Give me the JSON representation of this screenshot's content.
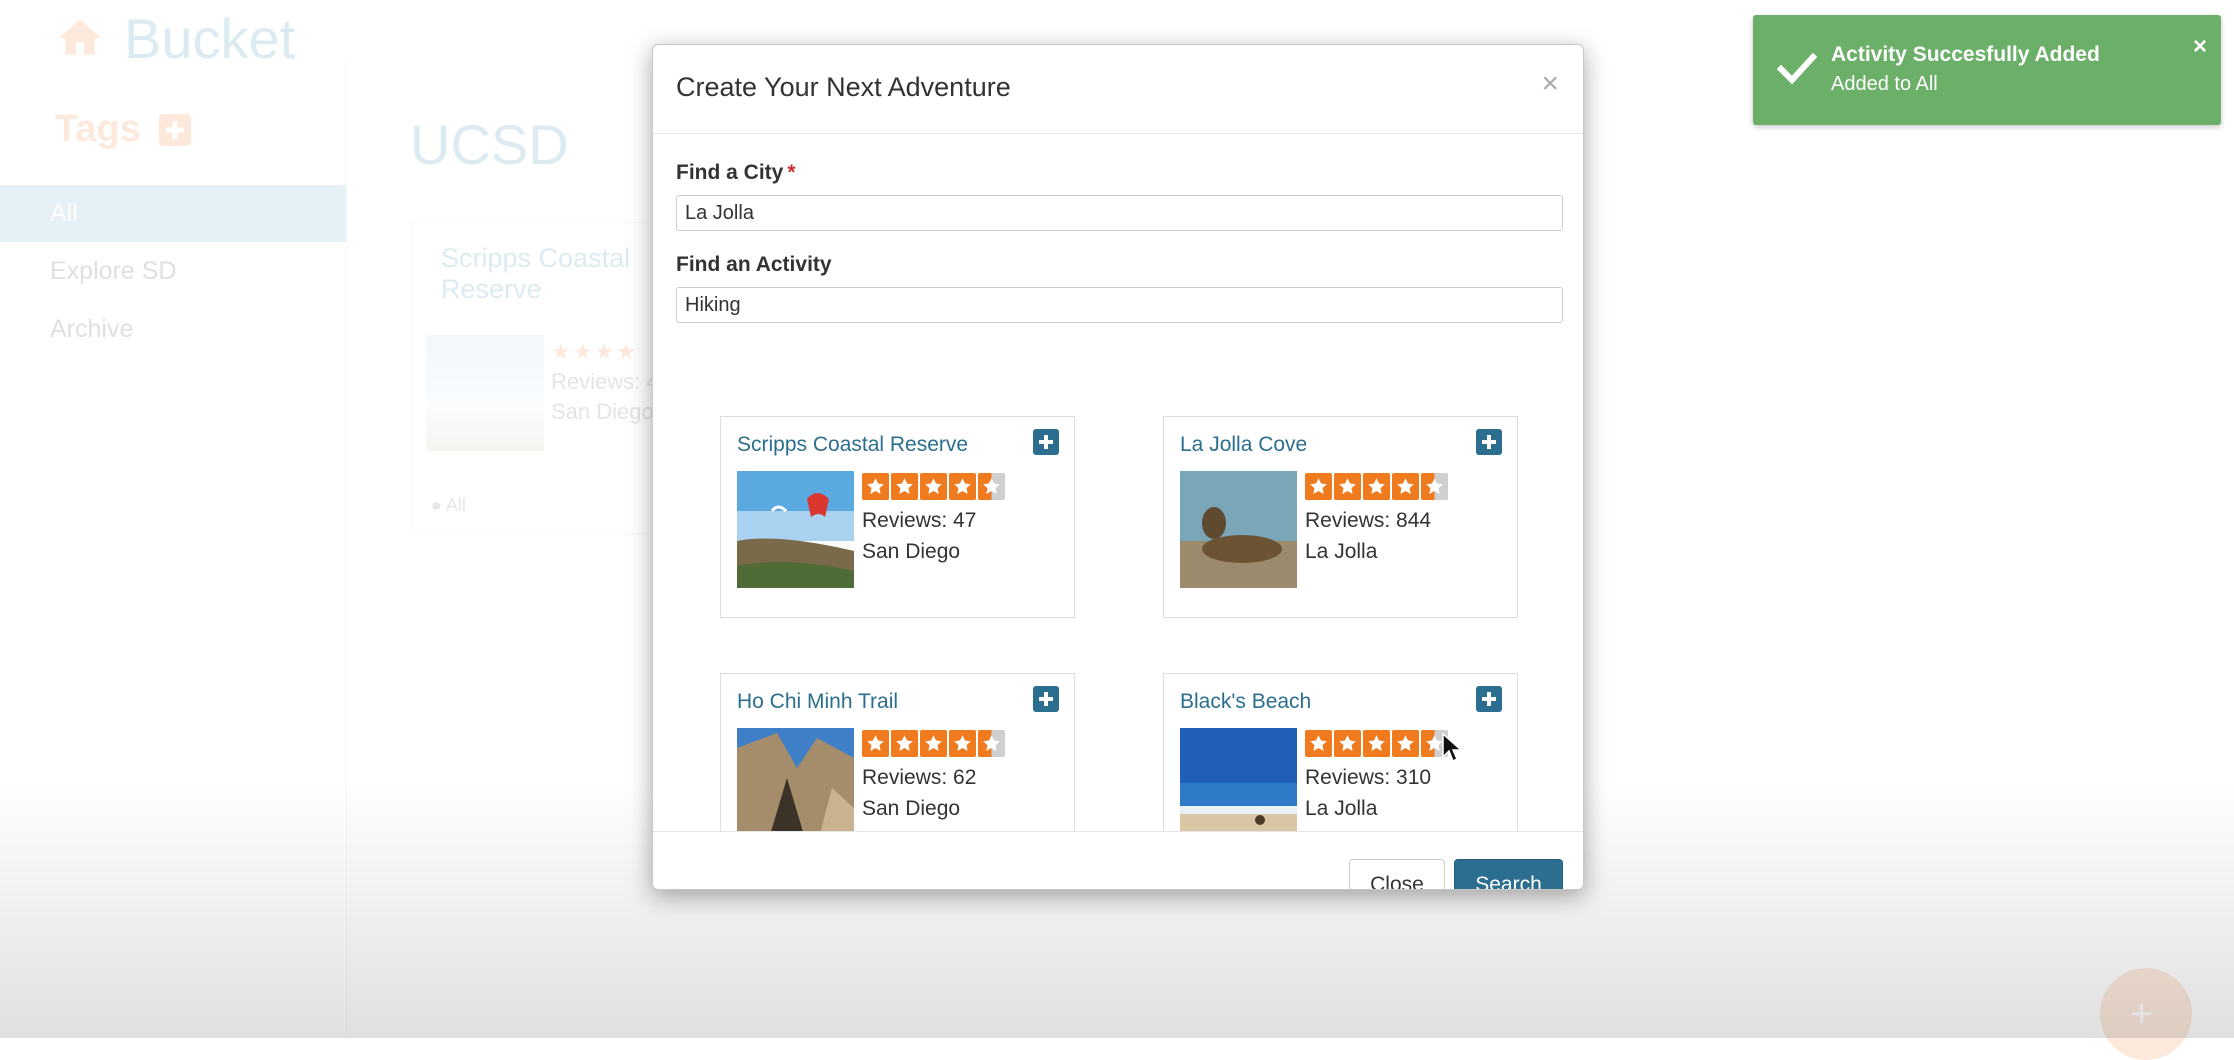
{
  "app": {
    "name": "Bucket",
    "tags_heading": "Tags",
    "sidebar": [
      {
        "label": "All",
        "active": true
      },
      {
        "label": "Explore SD",
        "active": false
      },
      {
        "label": "Archive",
        "active": false
      }
    ],
    "page_title": "UCSD",
    "background_card": {
      "title": "Scripps Coastal Reserve",
      "stars": "★★★★",
      "reviews": "Reviews: 4",
      "city": "San Diego",
      "tag": "All"
    }
  },
  "modal": {
    "title": "Create Your Next Adventure",
    "close_symbol": "×",
    "city_label": "Find a City",
    "required_mark": "*",
    "city_value": "La Jolla",
    "activity_label": "Find an Activity",
    "activity_value": "Hiking",
    "results": [
      {
        "title": "Scripps Coastal Reserve",
        "rating": 4.5,
        "reviews": "Reviews: 47",
        "city": "San Diego",
        "image_icon": "paraglider-coast-photo"
      },
      {
        "title": "La Jolla Cove",
        "rating": 4.5,
        "reviews": "Reviews: 844",
        "city": "La Jolla",
        "image_icon": "sea-lion-photo"
      },
      {
        "title": "Ho Chi Minh Trail",
        "rating": 4.5,
        "reviews": "Reviews: 62",
        "city": "San Diego",
        "image_icon": "canyon-rock-photo"
      },
      {
        "title": "Black's Beach",
        "rating": 4.5,
        "reviews": "Reviews: 310",
        "city": "La Jolla",
        "image_icon": "beach-photo"
      }
    ],
    "close_button": "Close",
    "search_button": "Search"
  },
  "toast": {
    "title": "Activity Succesfully Added",
    "message": "Added to All",
    "close_symbol": "×",
    "color": "#5fa95c"
  },
  "colors": {
    "primary": "#2b6e8f",
    "star": "#f07a1e",
    "tag_accent": "#e8741e"
  }
}
